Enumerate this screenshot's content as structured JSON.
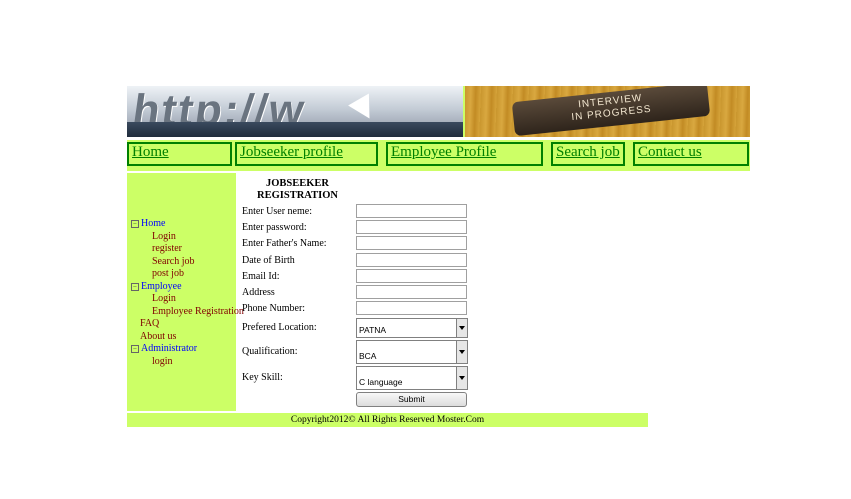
{
  "banner": {
    "left_image": {
      "icon": "http-url-image",
      "text": "http://w"
    },
    "right_image": {
      "icon": "interview-sign-image",
      "line1": "INTERVIEW",
      "line2": "IN PROGRESS"
    }
  },
  "nav": {
    "home": "Home",
    "jobseeker_profile": "Jobseeker profile",
    "employee_profile": "Employee Profile",
    "search_job": "Search job",
    "contact_us": "Contact us"
  },
  "sidebar": {
    "home": "Home",
    "home_children": [
      "Login",
      "register",
      "Search job",
      "post job"
    ],
    "employee": "Employee",
    "employee_children": [
      "Login",
      "Employee Registration"
    ],
    "faq": "FAQ",
    "about_us": "About us",
    "administrator": "Administrator",
    "administrator_children": [
      "login"
    ],
    "toggle_glyph": "−"
  },
  "form": {
    "title_line1": "JOBSEEKER",
    "title_line2": "REGISTRATION",
    "labels": {
      "username": "Enter User neme:",
      "password": "Enter password:",
      "father": "Enter Father's Name:",
      "dob": "Date of Birth",
      "email": "Email Id:",
      "address": "Address",
      "phone": "Phone Number:",
      "location": "Prefered Location:",
      "qualification": "Qualification:",
      "skill": "Key Skill:"
    },
    "values": {
      "username": "",
      "password": "",
      "father": "",
      "dob": "",
      "email": "",
      "address": "",
      "phone": ""
    },
    "selects": {
      "location": "PATNA",
      "qualification": "BCA",
      "skill": "C language"
    },
    "submit": "Submit"
  },
  "footer": "Copyright2012© All Rights Reserved Moster.Com",
  "colors": {
    "accent": "#ccff66",
    "nav_text": "#008000",
    "link_blue": "#0000ff",
    "link_dark": "#800000"
  }
}
